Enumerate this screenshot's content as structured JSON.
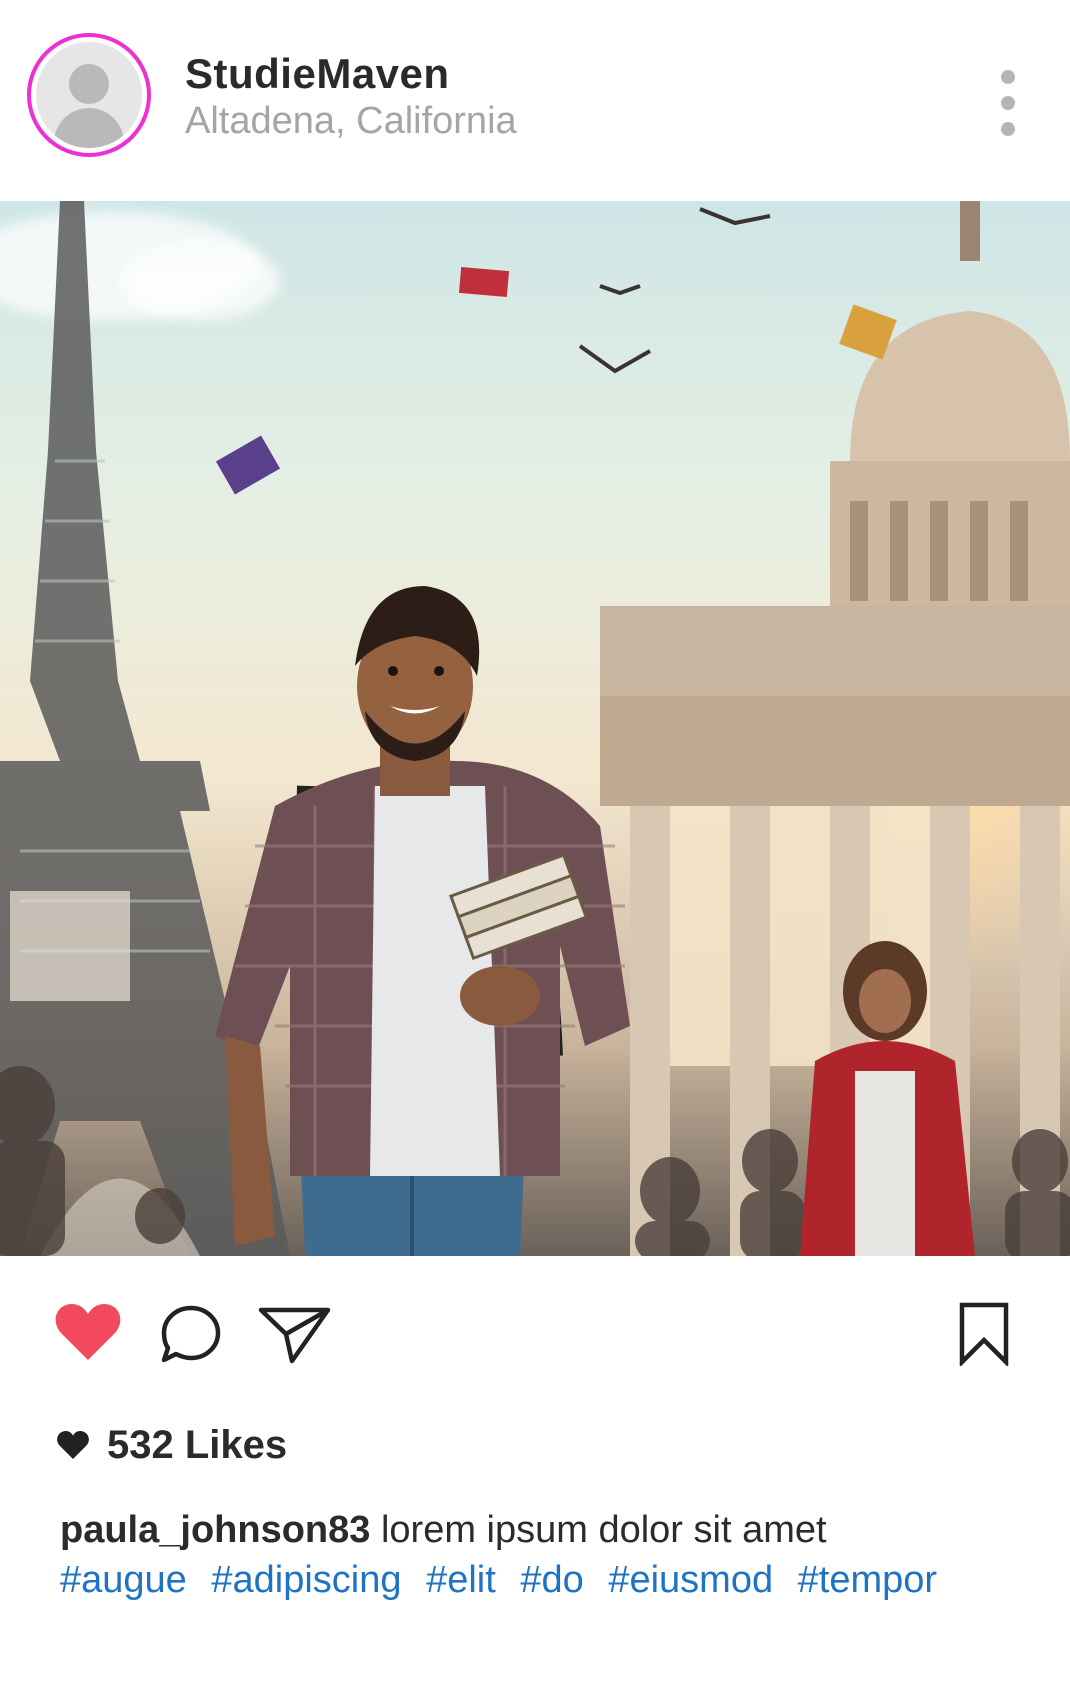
{
  "post": {
    "username": "StudieMaven",
    "location": "Altadena, California"
  },
  "icons": {
    "avatar": "default-user-avatar",
    "more": "vertical-ellipsis",
    "like": "heart-filled",
    "comment": "speech-bubble",
    "share": "paper-plane",
    "save": "bookmark"
  },
  "colors": {
    "avatar_ring": "#ee2fd2",
    "like_heart": "#f24a5c",
    "hashtag": "#1f73c4"
  },
  "likes": {
    "text": "532 Likes"
  },
  "caption": {
    "user": "paula_johnson83",
    "text": "lorem ipsum dolor sit amet",
    "hashtags": [
      "#augue",
      "#adipiscing",
      "#elit",
      "#do",
      "#eiusmod",
      "#tempor"
    ]
  }
}
